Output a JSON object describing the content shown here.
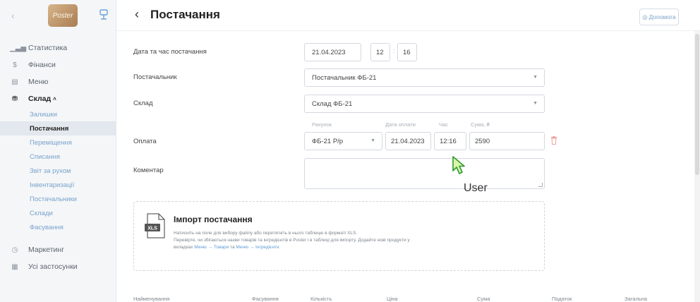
{
  "sidebar": {
    "logo_text": "Poster",
    "items": [
      {
        "label": "Статистика",
        "icon": "bar-chart-icon",
        "glyph": "▁▃▅"
      },
      {
        "label": "Фінанси",
        "icon": "dollar-icon",
        "glyph": "$"
      },
      {
        "label": "Меню",
        "icon": "menu-doc-icon",
        "glyph": "▤"
      },
      {
        "label": "Склад",
        "icon": "warehouse-icon",
        "glyph": "⛃"
      }
    ],
    "warehouse_sub": [
      "Залишки",
      "Постачання",
      "Переміщення",
      "Списання",
      "Звіт за рухом",
      "Інвентаризації",
      "Постачальники",
      "Склади",
      "Фасування"
    ],
    "bottom_items": [
      {
        "label": "Маркетинг",
        "icon": "marketing-icon",
        "glyph": "◷"
      },
      {
        "label": "Усі застосунки",
        "icon": "apps-icon",
        "glyph": "▦"
      }
    ]
  },
  "header": {
    "back_glyph": "‹",
    "title": "Постачання",
    "help_label": "Допомога"
  },
  "form": {
    "date_label": "Дата та час постачання",
    "date": "21.04.2023",
    "hour": "12",
    "minute": "16",
    "supplier_label": "Постачальник",
    "supplier": "Постачальник ФБ-21",
    "warehouse_label": "Склад",
    "warehouse": "Склад ФБ-21",
    "payment_label": "Оплата",
    "payment": {
      "account_label": "Рахунок",
      "date_label": "Дата оплати",
      "time_label": "Час",
      "sum_label": "Сума, ₴",
      "account": "ФБ-21 Р/р",
      "date": "21.04.2023",
      "time": "12:16",
      "sum": "2590"
    },
    "comment_label": "Коментар"
  },
  "overlay": {
    "user_label": "User"
  },
  "import": {
    "icon_text": "XLS",
    "title": "Імпорт постачання",
    "line1": "Натисніть на поле для вибору файлу або перетягніть в нього таблицю в форматі XLS.",
    "line2": "Перевірте, чи збігаються назви товарів та інгредієнтів в Poster і в таблиці для імпорту. Додайте нові продукти у",
    "line3_prefix": "вкладках ",
    "link1": "Меню → Товари",
    "and": " та ",
    "link2": "Меню → Інгредієнти"
  },
  "table_headers": [
    "Найменування",
    "Фасування",
    "Кількість",
    "Ціна",
    "Сума",
    "Податок",
    "Загальна"
  ]
}
